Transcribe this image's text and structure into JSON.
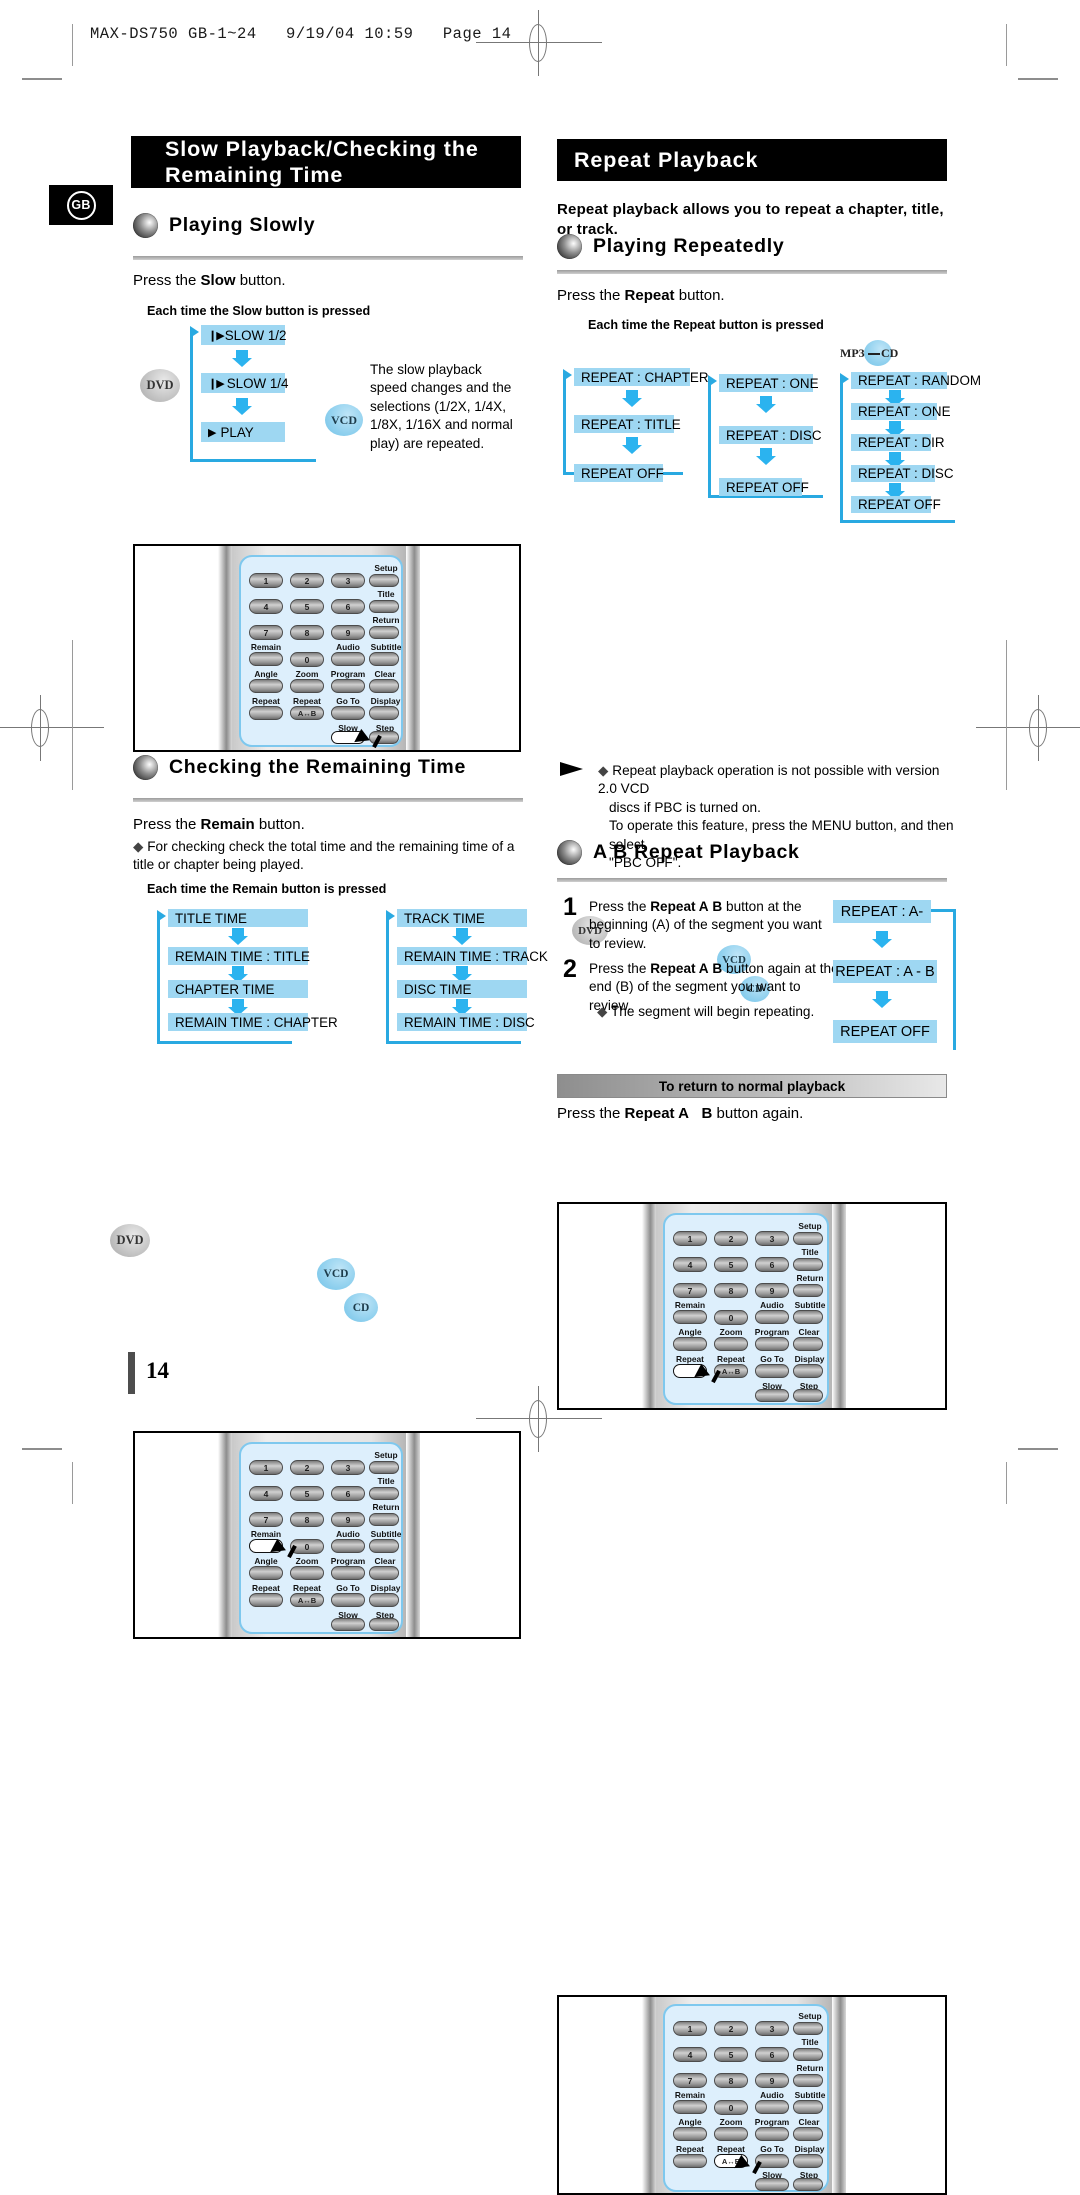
{
  "print_header": "MAX-DS750 GB-1~24   9/19/04 10:59   Page 14",
  "locale_badge": "GB",
  "page_number": "14",
  "left": {
    "banner_line1": "Slow Playback/Checking the",
    "banner_line2": "Remaining Time",
    "section1": {
      "heading": "Playing Slowly",
      "instruction_pre": "Press the ",
      "instruction_bold": "Slow",
      "instruction_post": " button.",
      "caption": "Each time the Slow button is pressed",
      "dvd_badge": "DVD",
      "vcd_badge": "VCD",
      "dvd_steps": [
        "SLOW 1/2",
        "SLOW 1/4",
        "PLAY"
      ],
      "vcd_note": "The slow playback speed changes and the selections (1/2X, 1/4X, 1/8X, 1/16X and normal play) are repeated."
    },
    "section2": {
      "heading": "Checking the Remaining Time",
      "instruction_pre": "Press the ",
      "instruction_bold": "Remain",
      "instruction_post": " button.",
      "bullet": "For checking check the total time and the remaining time of a title or chapter being played.",
      "caption": "Each time the Remain button is pressed",
      "dvd_badge": "DVD",
      "vcd_badge": "VCD",
      "cd_badge": "CD",
      "dvd_steps": [
        "TITLE TIME",
        "REMAIN TIME : TITLE",
        "CHAPTER TIME",
        "REMAIN TIME : CHAPTER"
      ],
      "vcdcd_steps": [
        "TRACK TIME",
        "REMAIN TIME : TRACK",
        "DISC TIME",
        "REMAIN TIME : DISC"
      ]
    }
  },
  "right": {
    "banner": "Repeat Playback",
    "intro": "Repeat playback allows you to repeat a chapter, title, or track.",
    "section1": {
      "heading": "Playing Repeatedly",
      "instruction_pre": "Press the ",
      "instruction_bold": "Repeat",
      "instruction_post": " button.",
      "caption": "Each time the Repeat button is pressed",
      "dvd_badge": "DVD",
      "vcd_badge": "VCD",
      "cd_badge": "CD",
      "mp3_badge_left": "MP3",
      "mp3_badge_right": "CD",
      "dvd_steps": [
        "REPEAT : CHAPTER",
        "REPEAT : TITLE",
        "REPEAT OFF"
      ],
      "vcdcd_steps": [
        "REPEAT : ONE",
        "REPEAT : DISC",
        "REPEAT OFF"
      ],
      "mp3_steps": [
        "REPEAT : RANDOM",
        "REPEAT : ONE",
        "REPEAT : DIR",
        "REPEAT : DISC",
        "REPEAT OFF"
      ]
    },
    "note": {
      "line1": "Repeat playback operation is not possible with version 2.0 VCD",
      "line2": "discs if PBC is turned on.",
      "line3": "To operate this feature, press the MENU button, and then select",
      "line4": "\"PBC OFF\"."
    },
    "section2": {
      "heading": "A  B Repeat Playback",
      "steps": [
        {
          "num": "1",
          "pre": "Press the ",
          "bold1": "Repeat A",
          "mid": "   ",
          "bold2": "B",
          "post": " button at the beginning (A) of the segment you want to review."
        },
        {
          "num": "2",
          "pre": "Press the ",
          "bold1": "Repeat A",
          "mid": "   ",
          "bold2": "B",
          "post": " button again at the end (B) of the segment you want to review."
        }
      ],
      "step2_bullet": "The segment will begin repeating.",
      "flow_steps": [
        "REPEAT : A-",
        "REPEAT : A - B",
        "REPEAT OFF"
      ],
      "return_bar": "To return to normal playback",
      "return_pre": "Press the ",
      "return_bold1": "Repeat A",
      "return_bold2": "B",
      "return_post": " button again."
    }
  },
  "remote": {
    "keys_numeric": [
      "1",
      "2",
      "3",
      "4",
      "5",
      "6",
      "7",
      "8",
      "9",
      "0"
    ],
    "labels": [
      "Setup",
      "Title",
      "Return",
      "Remain",
      "Audio",
      "Subtitle",
      "Angle",
      "Zoom",
      "Program",
      "Clear",
      "Repeat",
      "Repeat",
      "Go To",
      "Display",
      "Slow",
      "Step"
    ],
    "repeat_ab_key": "A↔B",
    "highlighted": [
      "Slow",
      "Remain",
      "Repeat",
      "Repeat A↔B"
    ]
  },
  "colors": {
    "flow_box": "#9ed7f2",
    "arrow": "#2bb3ef",
    "loop_line": "#29a9e1",
    "panel": "#ddeffc",
    "panel_border": "#7ec8ee",
    "banner": "#000000"
  }
}
